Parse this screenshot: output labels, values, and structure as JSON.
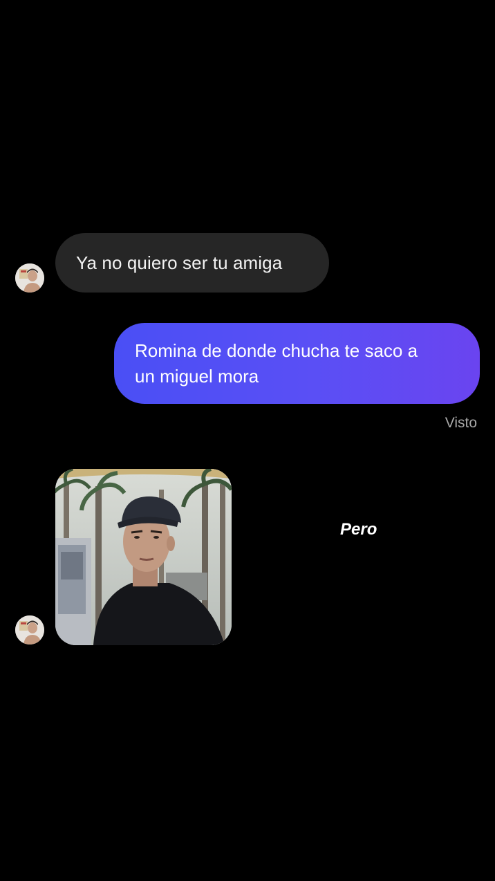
{
  "thread": {
    "contact_avatar_icon": "profile-avatar-icon",
    "received_message": "Ya no quiero ser tu amiga",
    "sent_message_line1": "Romina de donde chucha te saco a",
    "sent_message_line2": "un miguel mora",
    "seen_status": "Visto",
    "photo_message_icon": "photo-of-young-man-in-cap-icon"
  },
  "overlay": {
    "caption": "Pero"
  },
  "colors": {
    "background": "#000000",
    "received_bubble": "#262626",
    "sent_bubble_start": "#4a4ff5",
    "sent_bubble_end": "#6a44f0",
    "seen_text": "#a8a8a8"
  }
}
